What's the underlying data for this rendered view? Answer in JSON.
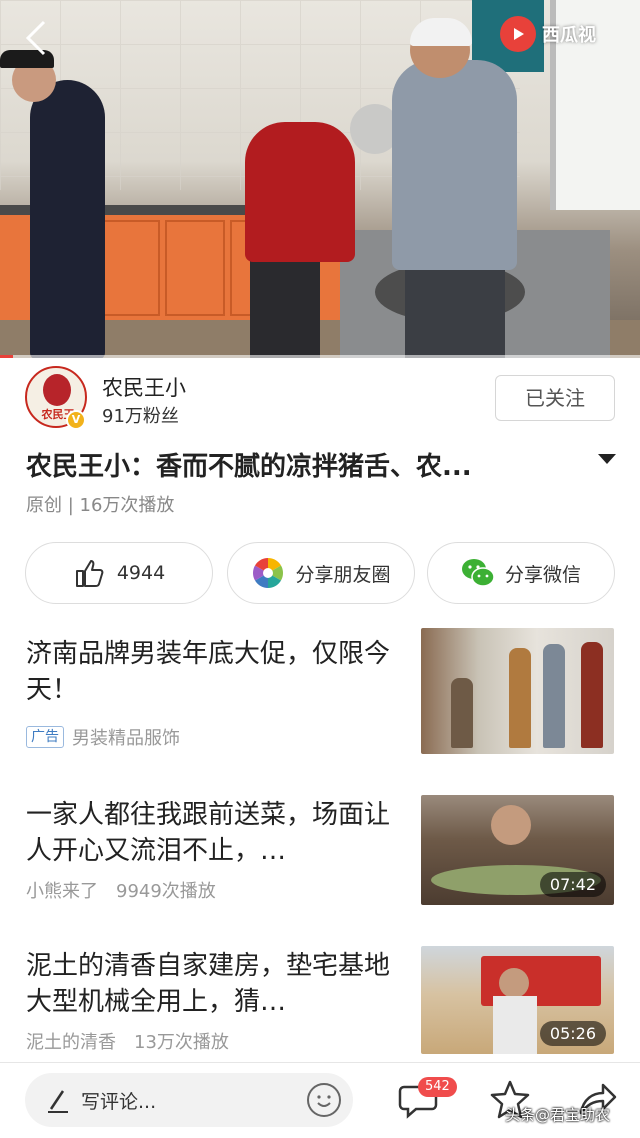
{
  "video": {
    "watermark_text": "西瓜视",
    "back_icon": "chevron-left-icon",
    "progress_fraction": 0.02
  },
  "author": {
    "name": "农民王小",
    "fans": "91万粉丝",
    "avatar_text": "农民王",
    "verified_badge": "V",
    "follow_label": "已关注"
  },
  "video_info": {
    "title": "农民王小：香而不腻的凉拌猪舌、农...",
    "meta": "原创 | 16万次播放"
  },
  "actions": {
    "like_count": "4944",
    "moments_label": "分享朋友圈",
    "wechat_label": "分享微信"
  },
  "feed": [
    {
      "title": "济南品牌男装年底大促，仅限今天！",
      "ad_tag": "广告",
      "source": "男装精品服饰"
    },
    {
      "title": "一家人都往我跟前送菜，场面让人开心又流泪不止，…",
      "source": "小熊来了",
      "plays": "9949次播放",
      "duration": "07:42"
    },
    {
      "title": "泥土的清香自家建房，垫宅基地大型机械全用上，猜…",
      "source": "泥土的清香",
      "plays": "13万次播放",
      "duration": "05:26"
    }
  ],
  "bottom_bar": {
    "comment_placeholder": "写评论...",
    "comment_count": "542",
    "brand_watermark": "头条@君宝助农"
  },
  "colors": {
    "accent_red": "#e8413a",
    "ad_blue": "#3f7cc2",
    "text_primary": "#222222",
    "text_secondary": "#999999"
  }
}
